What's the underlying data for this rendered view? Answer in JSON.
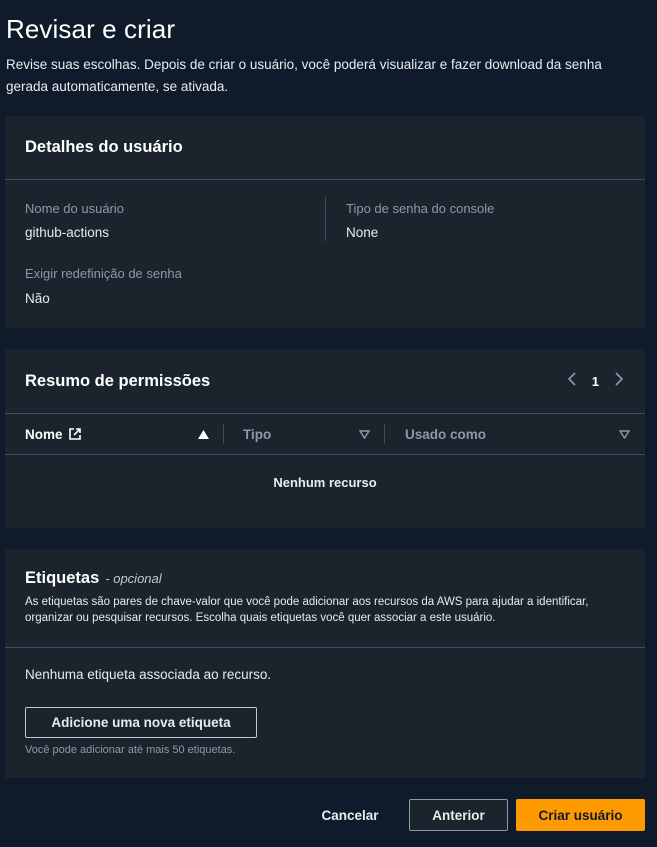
{
  "page": {
    "title": "Revisar e criar",
    "description": "Revise suas escolhas. Depois de criar o usuário, você poderá visualizar e fazer download da senha gerada automaticamente, se ativada."
  },
  "user_details": {
    "title": "Detalhes do usuário",
    "username_label": "Nome do usuário",
    "username_value": "github-actions",
    "console_password_label": "Tipo de senha do console",
    "console_password_value": "None",
    "require_reset_label": "Exigir redefinição de senha",
    "require_reset_value": "Não"
  },
  "permissions": {
    "title": "Resumo de permissões",
    "page_number": "1",
    "columns": [
      "Nome",
      "Tipo",
      "Usado como"
    ],
    "empty_text": "Nenhum recurso"
  },
  "tags": {
    "title": "Etiquetas",
    "optional": "- opcional",
    "description": "As etiquetas são pares de chave-valor que você pode adicionar aos recursos da AWS para ajudar a identificar, organizar ou pesquisar recursos. Escolha quais etiquetas você quer associar a este usuário.",
    "none_text": "Nenhuma etiqueta associada ao recurso.",
    "add_button": "Adicione uma nova etiqueta",
    "hint": "Você pode adicionar até mais 50 etiquetas."
  },
  "footer": {
    "cancel": "Cancelar",
    "previous": "Anterior",
    "create": "Criar usuário"
  },
  "colors": {
    "background": "#0f1b2a",
    "card": "#1b232d",
    "primary": "#ff9900"
  }
}
